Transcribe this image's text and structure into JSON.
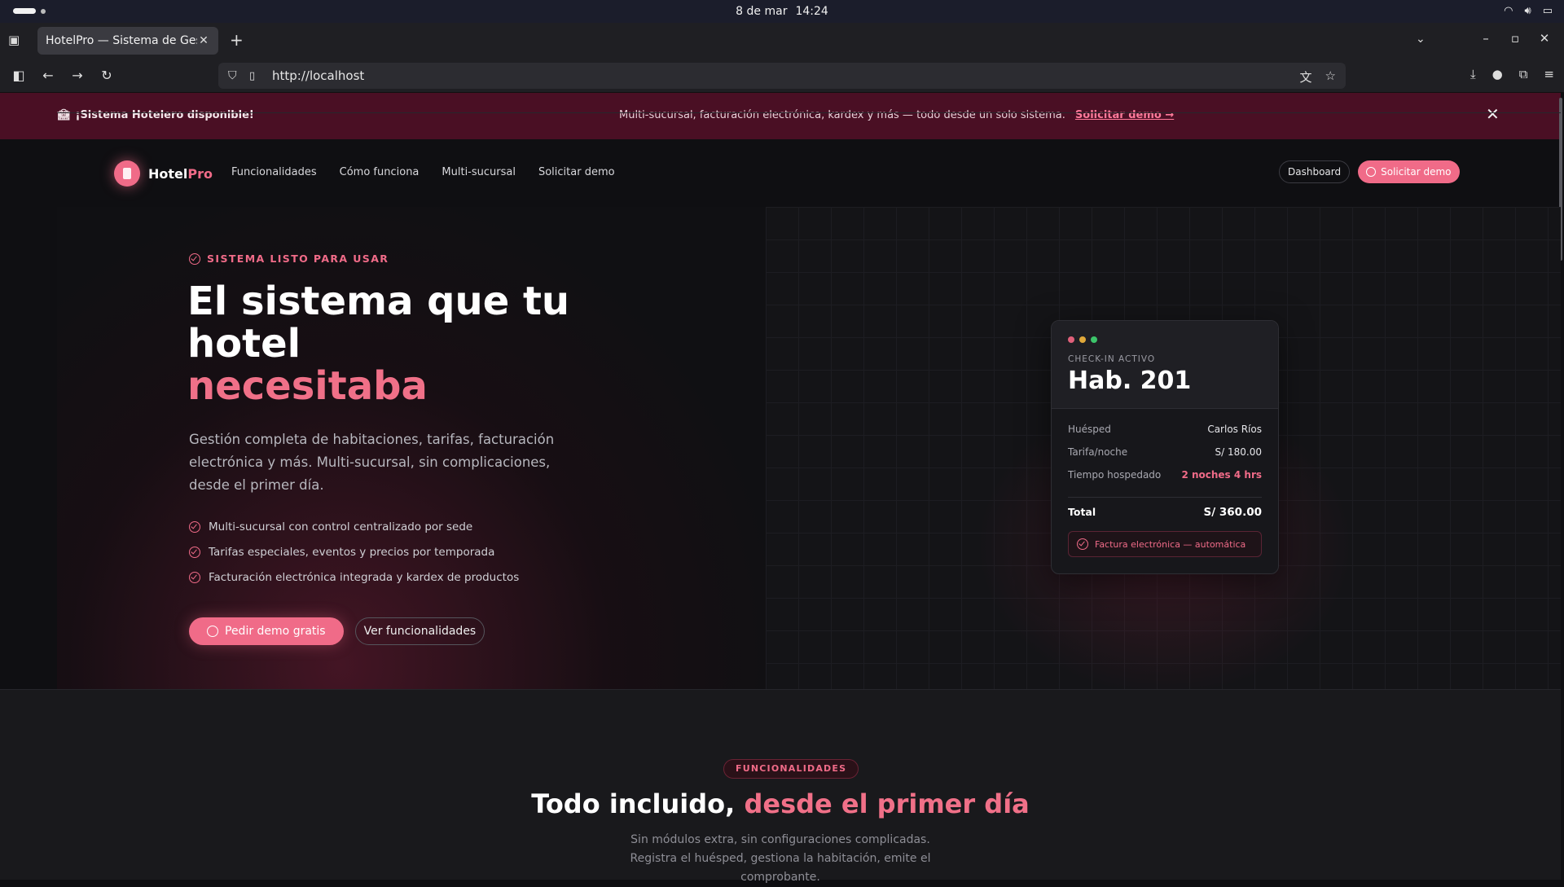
{
  "os": {
    "date": "8 de mar",
    "time": "14:24"
  },
  "browser": {
    "tab_title": "HotelPro — Sistema de Gestión",
    "url": "http://localhost"
  },
  "announcement": {
    "title": "¡Sistema Hotelero disponible!",
    "message": "Multi-sucursal, facturación electrónica, kardex y más — todo desde un solo sistema.",
    "link": "Solicitar demo →"
  },
  "header": {
    "brand_main": "Hotel",
    "brand_accent": "Pro",
    "nav": [
      "Funcionalidades",
      "Cómo funciona",
      "Multi-sucursal",
      "Solicitar demo"
    ],
    "dashboard_label": "Dashboard",
    "demo_label": "Solicitar demo"
  },
  "hero": {
    "eyebrow": "SISTEMA LISTO PARA USAR",
    "title_line1": "El sistema que tu hotel",
    "title_accent": "necesitaba",
    "description": "Gestión completa de habitaciones, tarifas, facturación electrónica y más. Multi-sucursal, sin complicaciones, desde el primer día.",
    "bullets": [
      "Multi-sucursal con control centralizado por sede",
      "Tarifas especiales, eventos y precios por temporada",
      "Facturación electrónica integrada y kardex de productos"
    ],
    "cta_primary": "Pedir demo gratis",
    "cta_secondary": "Ver funcionalidades"
  },
  "card": {
    "eyebrow": "CHECK-IN ACTIVO",
    "room": "Hab. 201",
    "rows": [
      {
        "label": "Huésped",
        "value": "Carlos Ríos"
      },
      {
        "label": "Tarifa/noche",
        "value": "S/ 180.00"
      },
      {
        "label": "Tiempo hospedado",
        "value": "2 noches 4 hrs"
      }
    ],
    "total_label": "Total",
    "total_value": "S/ 360.00",
    "invoice": "Factura electrónica — automática",
    "dot_colors": [
      "#e0607a",
      "#e0a83a",
      "#3cc46a"
    ]
  },
  "features": {
    "badge": "FUNCIONALIDADES",
    "title_main": "Todo incluido,",
    "title_accent": "desde el primer día",
    "subtitle": "Sin módulos extra, sin configuraciones complicadas. Registra el huésped, gestiona la habitación, emite el comprobante."
  },
  "colors": {
    "accent": "#f06b88",
    "banner": "#4a0f24"
  }
}
